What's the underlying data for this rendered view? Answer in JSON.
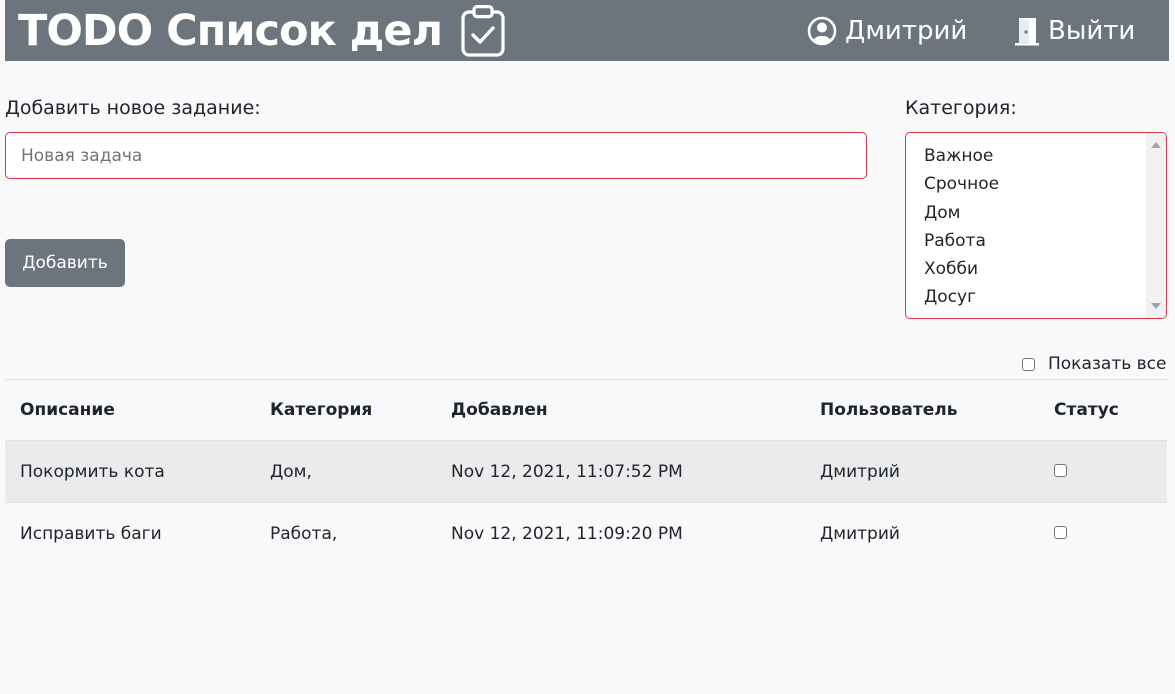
{
  "header": {
    "title": "TODO Список дел",
    "user_name": "Дмитрий",
    "logout_label": "Выйти",
    "background_color": "#6c757d",
    "icons": {
      "brand": "clipboard-check-icon",
      "user": "person-circle-icon",
      "logout": "door-open-icon"
    }
  },
  "form": {
    "task_label": "Добавить новое задание:",
    "task_placeholder": "Новая задача",
    "task_value": "",
    "category_label": "Категория:",
    "categories": [
      "Важное",
      "Срочное",
      "Дом",
      "Работа",
      "Хобби",
      "Досуг"
    ],
    "add_button_label": "Добавить",
    "invalid_border_color": "#dc3545"
  },
  "filter": {
    "show_all_label": "Показать все",
    "show_all_checked": false
  },
  "table": {
    "columns": [
      "Описание",
      "Категория",
      "Добавлен",
      "Пользователь",
      "Статус"
    ],
    "rows": [
      {
        "description": "Покормить кота",
        "category": "Дом,",
        "added": "Nov 12, 2021, 11:07:52 PM",
        "user": "Дмитрий",
        "done": false
      },
      {
        "description": "Исправить баги",
        "category": "Работа,",
        "added": "Nov 12, 2021, 11:09:20 PM",
        "user": "Дмитрий",
        "done": false
      }
    ]
  }
}
